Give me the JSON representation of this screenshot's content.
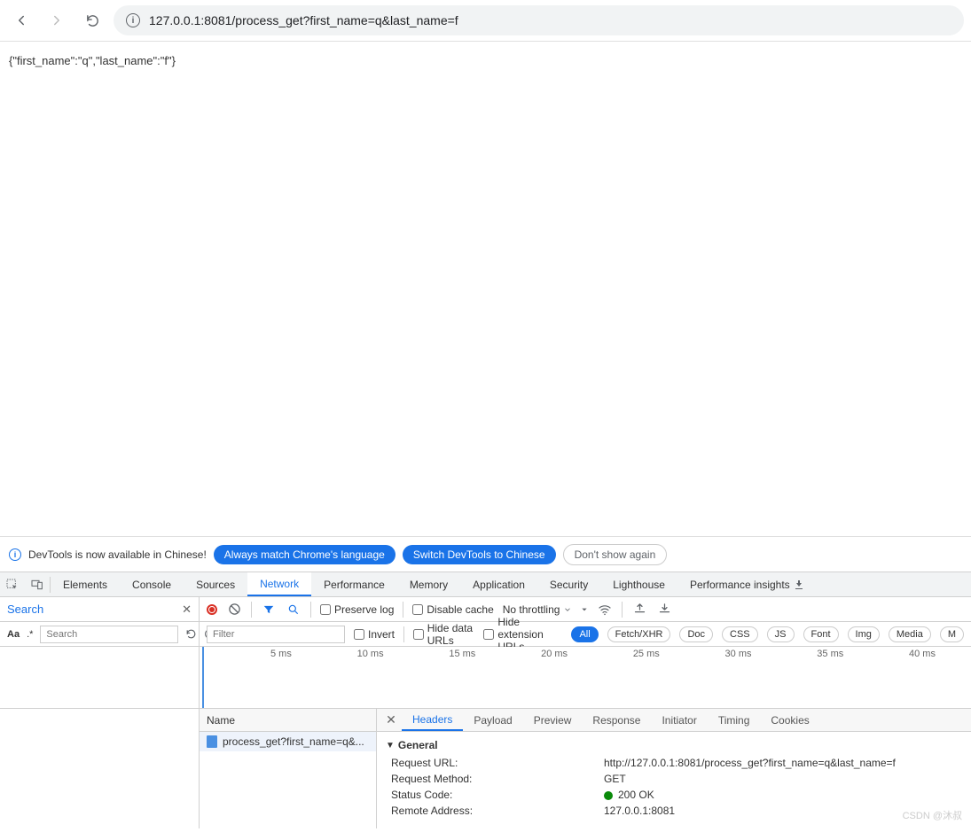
{
  "browser": {
    "url": "127.0.0.1:8081/process_get?first_name=q&last_name=f"
  },
  "page": {
    "body_text": "{\"first_name\":\"q\",\"last_name\":\"f\"}"
  },
  "lang_banner": {
    "text": "DevTools is now available in Chinese!",
    "btn1": "Always match Chrome's language",
    "btn2": "Switch DevTools to Chinese",
    "btn3": "Don't show again"
  },
  "devtools": {
    "tabs": [
      "Elements",
      "Console",
      "Sources",
      "Network",
      "Performance",
      "Memory",
      "Application",
      "Security",
      "Lighthouse",
      "Performance insights"
    ],
    "active_tab": "Network"
  },
  "search_strip": {
    "label": "Search",
    "preserve_log": "Preserve log",
    "disable_cache": "Disable cache",
    "throttling": "No throttling"
  },
  "filter_strip": {
    "aa": "Aa",
    "regex": ".*",
    "search_placeholder": "Search",
    "filter_placeholder": "Filter",
    "invert": "Invert",
    "hide_data": "Hide data URLs",
    "hide_ext": "Hide extension URLs",
    "types": [
      "All",
      "Fetch/XHR",
      "Doc",
      "CSS",
      "JS",
      "Font",
      "Img",
      "Media",
      "M"
    ]
  },
  "timeline": {
    "ticks": [
      "5 ms",
      "10 ms",
      "15 ms",
      "20 ms",
      "25 ms",
      "30 ms",
      "35 ms",
      "40 ms"
    ]
  },
  "requests": {
    "name_header": "Name",
    "rows": [
      {
        "name": "process_get?first_name=q&..."
      }
    ]
  },
  "details": {
    "tabs": [
      "Headers",
      "Payload",
      "Preview",
      "Response",
      "Initiator",
      "Timing",
      "Cookies"
    ],
    "active_tab": "Headers",
    "general_label": "General",
    "general": {
      "request_url_k": "Request URL:",
      "request_url_v": "http://127.0.0.1:8081/process_get?first_name=q&last_name=f",
      "request_method_k": "Request Method:",
      "request_method_v": "GET",
      "status_code_k": "Status Code:",
      "status_code_v": "200 OK",
      "remote_addr_k": "Remote Address:",
      "remote_addr_v": "127.0.0.1:8081"
    }
  },
  "watermark": "CSDN @沐叔"
}
